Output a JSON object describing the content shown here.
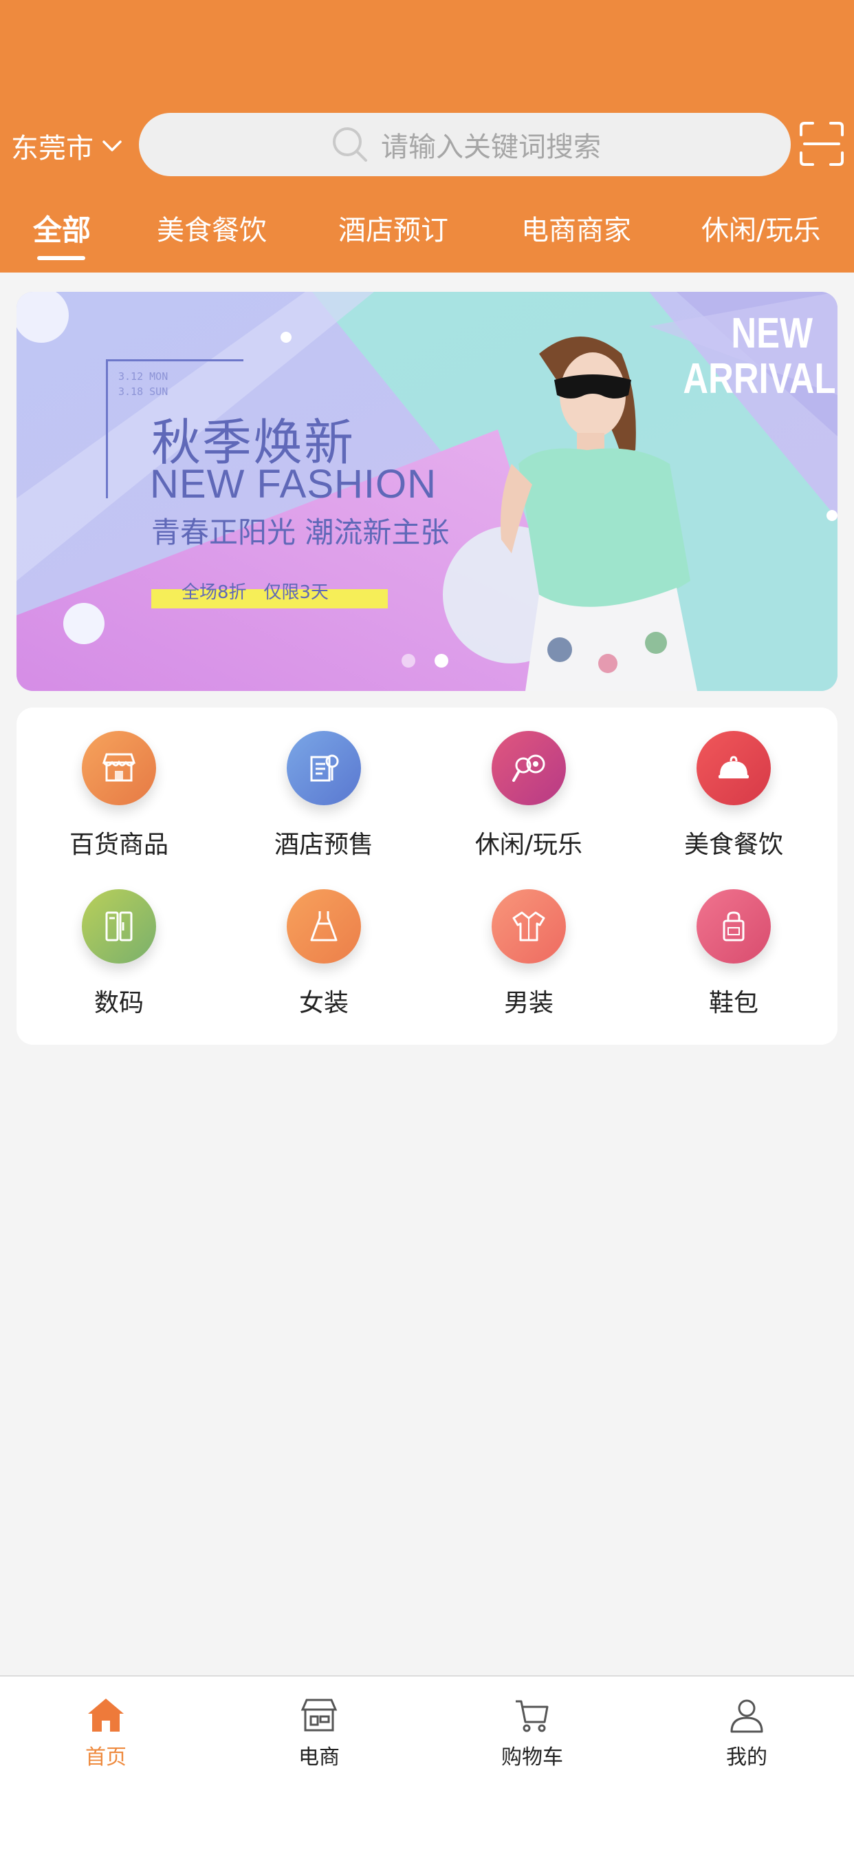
{
  "header": {
    "city": "东莞市",
    "search_placeholder": "请输入关键词搜索"
  },
  "tabs": [
    {
      "label": "全部",
      "active": true
    },
    {
      "label": "美食餐饮",
      "active": false
    },
    {
      "label": "酒店预订",
      "active": false
    },
    {
      "label": "电商商家",
      "active": false
    },
    {
      "label": "休闲/玩乐",
      "active": false
    }
  ],
  "banner": {
    "date_line1": "3.12 MON",
    "date_line2": "3.18 SUN",
    "title_cn": "秋季焕新",
    "title_en": "NEW FASHION",
    "subtitle": "青春正阳光 潮流新主张",
    "promo": "全场8折   仅限3天",
    "new_line1": "NEW",
    "new_line2": "ARRIVAL",
    "slide_count": 2,
    "active_slide": 2
  },
  "categories": [
    {
      "label": "百货商品",
      "icon": "store-icon",
      "color_from": "#f6a35c",
      "color_to": "#e67a45"
    },
    {
      "label": "酒店预售",
      "icon": "hotel-icon",
      "color_from": "#7aa6e6",
      "color_to": "#5a78d0"
    },
    {
      "label": "休闲/玩乐",
      "icon": "leisure-icon",
      "color_from": "#e0577e",
      "color_to": "#b73a86"
    },
    {
      "label": "美食餐饮",
      "icon": "food-icon",
      "color_from": "#f0575a",
      "color_to": "#d73a48"
    },
    {
      "label": "数码",
      "icon": "digital-icon",
      "color_from": "#b9cf5a",
      "color_to": "#7ab06c"
    },
    {
      "label": "女装",
      "icon": "dress-icon",
      "color_from": "#f7a15c",
      "color_to": "#ec7f4a"
    },
    {
      "label": "男装",
      "icon": "shirt-icon",
      "color_from": "#f8967a",
      "color_to": "#ee6b61"
    },
    {
      "label": "鞋包",
      "icon": "bag-icon",
      "color_from": "#f0738e",
      "color_to": "#d94d6f"
    }
  ],
  "bottom_nav": [
    {
      "label": "首页",
      "icon": "home-icon",
      "active": true
    },
    {
      "label": "电商",
      "icon": "shop-icon",
      "active": false
    },
    {
      "label": "购物车",
      "icon": "cart-icon",
      "active": false
    },
    {
      "label": "我的",
      "icon": "profile-icon",
      "active": false
    }
  ],
  "colors": {
    "accent": "#ee8a3e",
    "page_bg": "#f4f4f4"
  }
}
